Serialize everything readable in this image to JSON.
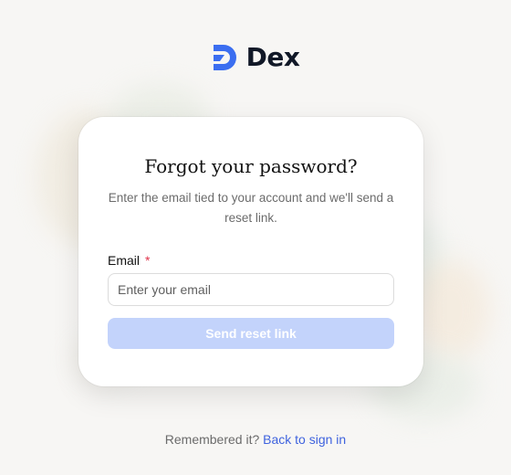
{
  "brand": {
    "name": "Dex",
    "icon": "dex-logo-icon",
    "accent_color": "#3b6ef0"
  },
  "card": {
    "title": "Forgot your password?",
    "subtitle": "Enter the email tied to your account and we'll send a reset link.",
    "email": {
      "label": "Email",
      "required_mark": "*",
      "placeholder": "Enter your email",
      "value": ""
    },
    "submit_label": "Send reset link",
    "submit_color": "#c3d3fb"
  },
  "footer": {
    "prompt": "Remembered it?",
    "link_label": "Back to sign in",
    "link_color": "#3f63de"
  }
}
